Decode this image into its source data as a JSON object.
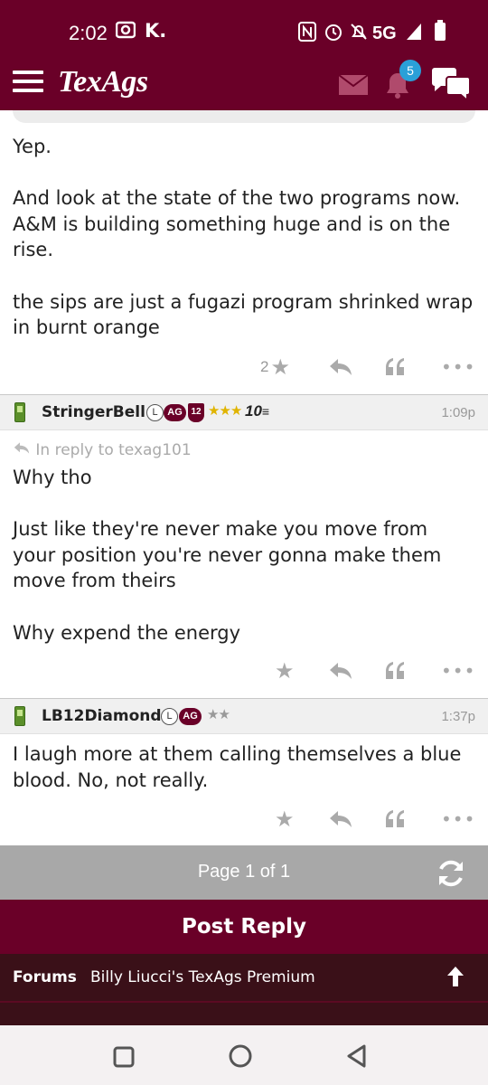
{
  "statusbar": {
    "time": "2:02",
    "k_label": "K.",
    "network": "5G"
  },
  "header": {
    "logo": "TexAgs",
    "notifications_count": "5"
  },
  "posts": [
    {
      "body": "Yep.\n\nAnd look at the state of the two programs now. A&M is building something huge and is on the rise.\n\nthe sips are just a fugazi program shrinked wrap in burnt orange",
      "star_count": "2"
    },
    {
      "username": "StringerBell",
      "badge_l": "L",
      "badge_ag": "AG",
      "badge_shield": "12",
      "stars": "★★★",
      "badge_10": "10",
      "time": "1:09p",
      "reply_to": "In reply to texag101",
      "body": "Why tho\n\nJust like they're never make you move from your position you're never gonna make them move from theirs\n\nWhy expend the energy"
    },
    {
      "username": "LB12Diamond",
      "badge_l": "L",
      "badge_ag": "AG",
      "stars": "★★",
      "time": "1:37p",
      "body": "I laugh more at them calling themselves a blue blood. No, not really."
    }
  ],
  "pager": {
    "label": "Page 1 of 1"
  },
  "post_reply_label": "Post Reply",
  "breadcrumbs": {
    "forums": "Forums",
    "board": "Billy Liucci's TexAgs Premium"
  },
  "colors": {
    "maroon": "#6a0028",
    "dark_maroon": "#3a1018",
    "pager_gray": "#a8a8a8",
    "gold_star": "#e0b400"
  },
  "icons": [
    "hamburger-icon",
    "mail-icon",
    "bell-icon",
    "chat-icon",
    "star-icon",
    "reply-icon",
    "quote-icon",
    "more-icon",
    "refresh-icon",
    "arrow-up-icon"
  ]
}
